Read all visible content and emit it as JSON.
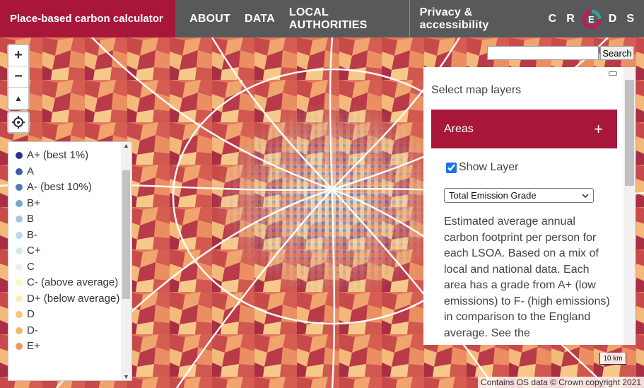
{
  "header": {
    "brand": "Place-based carbon calculator",
    "nav": [
      "ABOUT",
      "DATA",
      "LOCAL AUTHORITIES"
    ],
    "privacy": "Privacy & accessibility",
    "logo_text": "CREDS"
  },
  "map_controls": {
    "zoom_in": "+",
    "zoom_out": "−",
    "reset_bearing": "▲"
  },
  "legend": {
    "items": [
      {
        "label": "A+ (best 1%)",
        "color": "#2b2f8f"
      },
      {
        "label": "A",
        "color": "#3b60b0"
      },
      {
        "label": "A- (best 10%)",
        "color": "#4f78bb"
      },
      {
        "label": "B+",
        "color": "#73a7cf"
      },
      {
        "label": "B",
        "color": "#9ec8e1"
      },
      {
        "label": "B-",
        "color": "#b8d9ea"
      },
      {
        "label": "C+",
        "color": "#d6e9f1"
      },
      {
        "label": "C",
        "color": "#e8f1f3"
      },
      {
        "label": "C- (above average)",
        "color": "#fbf7c8"
      },
      {
        "label": "D+ (below average)",
        "color": "#fbeeb4"
      },
      {
        "label": "D",
        "color": "#f3c97c"
      },
      {
        "label": "D-",
        "color": "#eeb86e"
      },
      {
        "label": "E+",
        "color": "#e99a62"
      }
    ]
  },
  "search": {
    "placeholder": "",
    "button": "Search"
  },
  "panel": {
    "title": "Select map layers",
    "section": "Areas",
    "show_layer_label": "Show Layer",
    "show_layer_checked": true,
    "select_value": "Total Emission Grade",
    "description": "Estimated average annual carbon footprint per person for each LSOA. Based on a mix of local and national data. Each area has a grade from A+ (low emissions) to F- (high emissions) in comparison to the England average. See the"
  },
  "scale_label": "10 km",
  "attribution": "Contains OS data © Crown copyright 2021",
  "colors": {
    "brand": "#a8173a",
    "nav_bg": "#58595b"
  }
}
